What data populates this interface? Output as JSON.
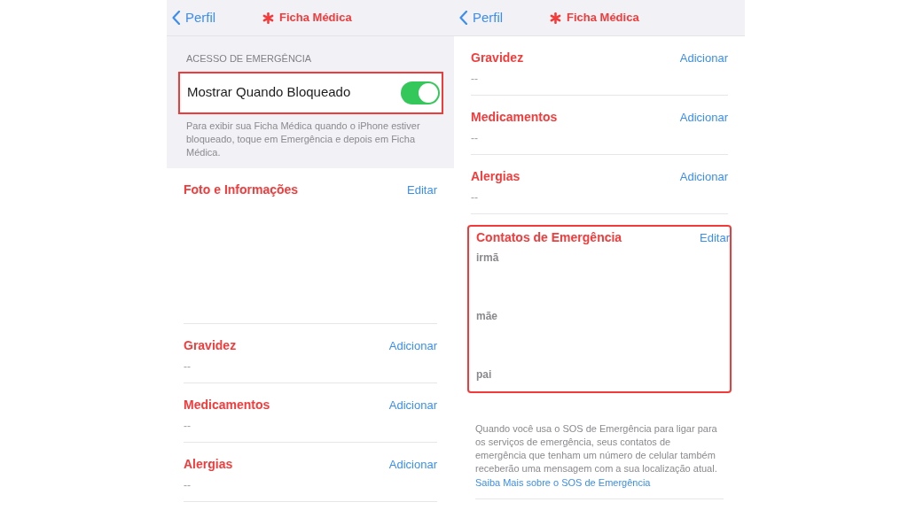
{
  "screens": [
    {
      "nav": {
        "back": "Perfil",
        "title": "Ficha Médica"
      },
      "blocks": [
        {
          "kind": "toggle_group",
          "header": "ACESSO DE EMERGÊNCIA",
          "label": "Mostrar Quando Bloqueado",
          "on": true,
          "highlighted": true,
          "footer": "Para exibir sua Ficha Médica quando o iPhone estiver bloqueado, toque em Emergência e depois em Ficha Médica."
        },
        {
          "kind": "photo_section",
          "title": "Foto e Informações",
          "action": "Editar"
        },
        {
          "kind": "section",
          "title": "Gravidez",
          "action": "Adicionar",
          "value": "--"
        },
        {
          "kind": "section",
          "title": "Medicamentos",
          "action": "Adicionar",
          "value": "--"
        },
        {
          "kind": "section",
          "title": "Alergias",
          "action": "Adicionar",
          "value": "--"
        }
      ]
    },
    {
      "nav": {
        "back": "Perfil",
        "title": "Ficha Médica"
      },
      "blocks": [
        {
          "kind": "section",
          "title": "Gravidez",
          "action": "Adicionar",
          "value": "--"
        },
        {
          "kind": "section",
          "title": "Medicamentos",
          "action": "Adicionar",
          "value": "--"
        },
        {
          "kind": "section",
          "title": "Alergias",
          "action": "Adicionar",
          "value": "--"
        },
        {
          "kind": "contacts",
          "title": "Contatos de Emergência",
          "action": "Editar",
          "highlighted": true,
          "items": [
            "irmã",
            "mãe",
            "pai"
          ]
        },
        {
          "kind": "note",
          "text": "Quando você usa o SOS de Emergência para ligar para os serviços de emergência, seus contatos de emergência que tenham um número de celular também receberão uma mensagem com a sua localização atual.",
          "link": "Saiba Mais sobre o SOS de Emergência"
        }
      ]
    }
  ]
}
